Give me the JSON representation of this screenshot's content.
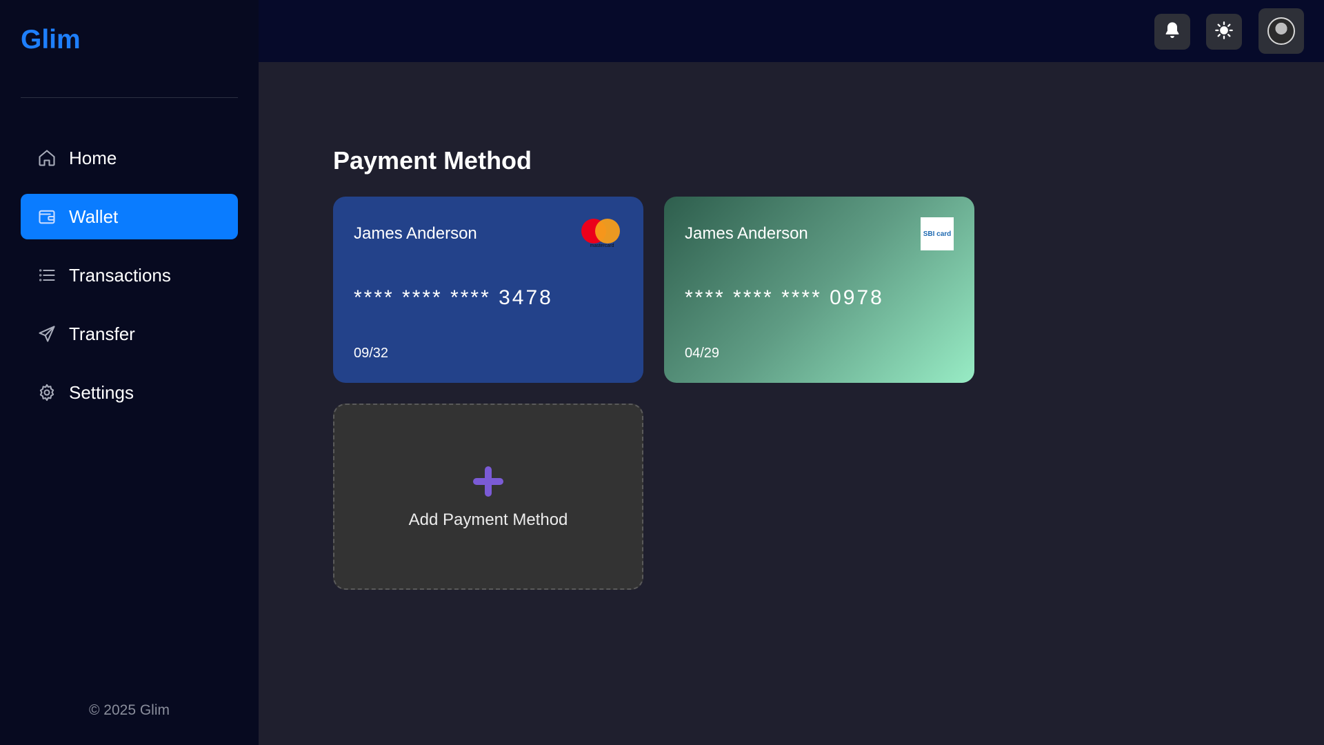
{
  "app": {
    "name": "Glim"
  },
  "sidebar": {
    "items": [
      {
        "label": "Home",
        "icon": "home-icon"
      },
      {
        "label": "Wallet",
        "icon": "wallet-icon",
        "active": true
      },
      {
        "label": "Transactions",
        "icon": "list-icon"
      },
      {
        "label": "Transfer",
        "icon": "send-icon"
      },
      {
        "label": "Settings",
        "icon": "gear-icon"
      }
    ],
    "footer": "© 2025 Glim"
  },
  "topbar": {
    "icons": [
      "bell-icon",
      "sun-icon",
      "avatar"
    ]
  },
  "main": {
    "title": "Payment Method",
    "cards": [
      {
        "holder": "James Anderson",
        "number": "**** **** **** 3478",
        "expiry": "09/32",
        "brand": "mastercard",
        "brand_text": "mastercard",
        "color": "#23428a"
      },
      {
        "holder": "James Anderson",
        "number": "**** **** **** 0978",
        "expiry": "04/29",
        "brand": "sbicard",
        "brand_text": "SBI card",
        "color": "#5f9c84"
      }
    ],
    "add_label": "Add Payment Method"
  },
  "colors": {
    "accent": "#0a7cff",
    "sidebar_bg": "#070a20",
    "main_bg": "#1f1f2e",
    "plus": "#7b5bd6"
  }
}
